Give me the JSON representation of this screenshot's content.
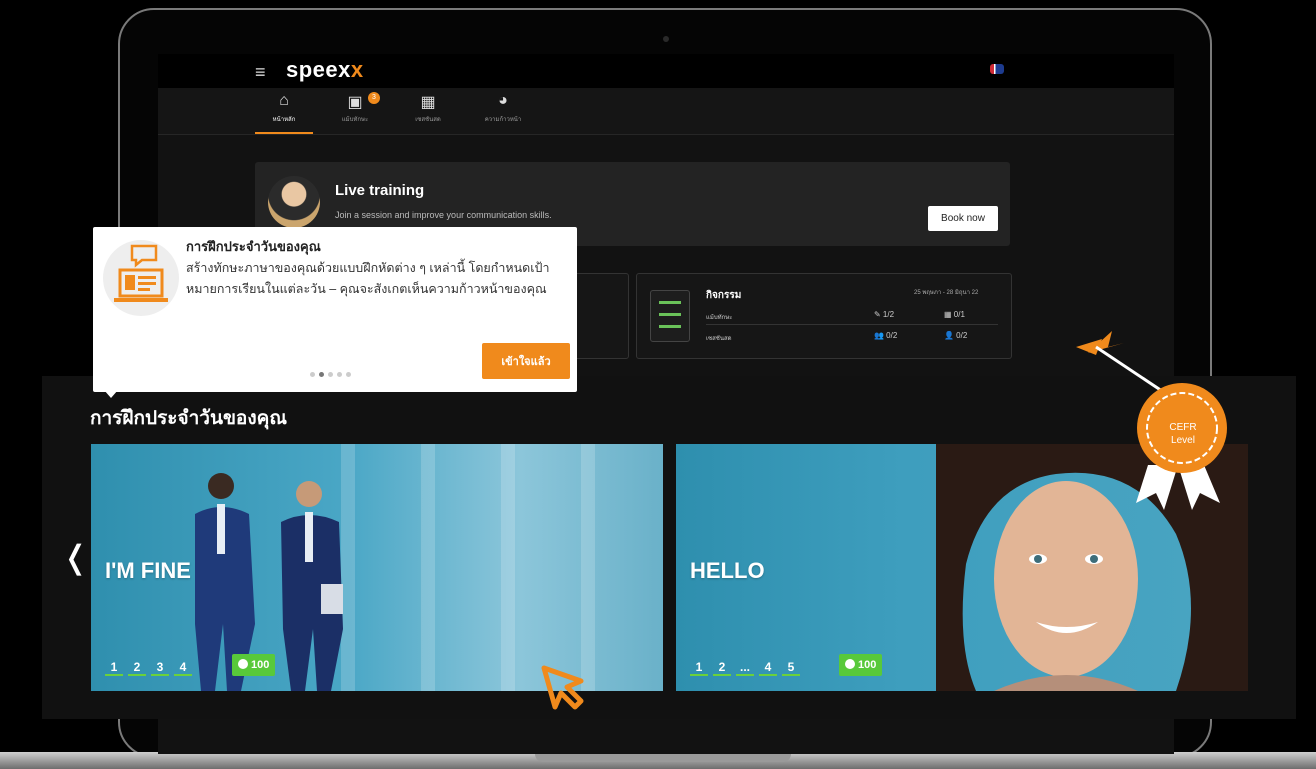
{
  "app": {
    "logo_main": "speex",
    "logo_accent": "x"
  },
  "nav": {
    "items": [
      {
        "label": "หน้าหลัก",
        "icon": "home-icon",
        "glyph": "⌂"
      },
      {
        "label": "แม้บทักษะ",
        "icon": "task-icon",
        "glyph": "▣",
        "badge": "3"
      },
      {
        "label": "เซสชันสด",
        "icon": "calendar-icon",
        "glyph": "▦"
      },
      {
        "label": "ความก้าวหน้า",
        "icon": "progress-icon",
        "glyph": "◕"
      }
    ]
  },
  "live_training": {
    "title": "Live training",
    "subtitle": "Join a session and improve your communication skills.",
    "button": "Book now"
  },
  "activity": {
    "title": "กิจกรรม",
    "date_range": "25 พฤษภา - 28 มิถุนา 22",
    "rows": [
      {
        "label": "แม้บทักษะ",
        "val1": "✎ 1/2",
        "val2": "▦ 0/1"
      },
      {
        "label": "เซสชันสด",
        "val1": "👥 0/2",
        "val2": "👤 0/2"
      }
    ]
  },
  "tooltip": {
    "title": "การฝึกประจำวันของคุณ",
    "body": "สร้างทักษะภาษาของคุณด้วยแบบฝึกหัดต่าง ๆ เหล่านี้ โดยกำหนดเป้าหมายการเรียนในแต่ละวัน – คุณจะสังเกตเห็นความก้าวหน้าของคุณ",
    "button": "เข้าใจแล้ว",
    "page_count": 5,
    "active_page": 2
  },
  "daily": {
    "title": "การฝึกประจำวันของคุณ",
    "cards": [
      {
        "title": "I'M FINE",
        "lessons": [
          "1",
          "2",
          "3",
          "4"
        ],
        "points": "100"
      },
      {
        "title": "HELLO",
        "lessons": [
          "1",
          "2",
          "...",
          "4",
          "5"
        ],
        "points": "100"
      }
    ]
  },
  "badge": {
    "line1": "CEFR",
    "line2": "Level"
  },
  "colors": {
    "accent": "#f08a1c",
    "points_green": "#58c93a",
    "card_blue": "#3e9ebe"
  }
}
